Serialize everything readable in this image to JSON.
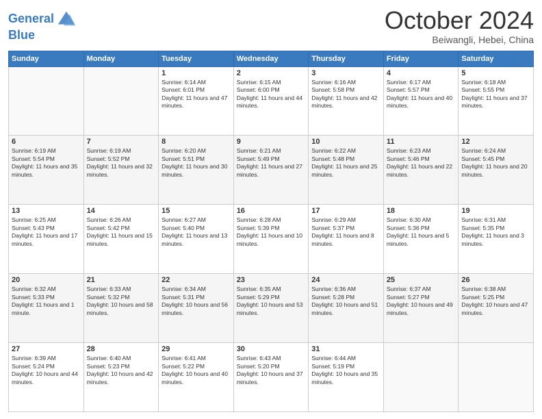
{
  "header": {
    "logo_line1": "General",
    "logo_line2": "Blue",
    "month": "October 2024",
    "location": "Beiwangli, Hebei, China"
  },
  "weekdays": [
    "Sunday",
    "Monday",
    "Tuesday",
    "Wednesday",
    "Thursday",
    "Friday",
    "Saturday"
  ],
  "weeks": [
    [
      {
        "day": "",
        "info": ""
      },
      {
        "day": "",
        "info": ""
      },
      {
        "day": "1",
        "info": "Sunrise: 6:14 AM\nSunset: 6:01 PM\nDaylight: 11 hours and 47 minutes."
      },
      {
        "day": "2",
        "info": "Sunrise: 6:15 AM\nSunset: 6:00 PM\nDaylight: 11 hours and 44 minutes."
      },
      {
        "day": "3",
        "info": "Sunrise: 6:16 AM\nSunset: 5:58 PM\nDaylight: 11 hours and 42 minutes."
      },
      {
        "day": "4",
        "info": "Sunrise: 6:17 AM\nSunset: 5:57 PM\nDaylight: 11 hours and 40 minutes."
      },
      {
        "day": "5",
        "info": "Sunrise: 6:18 AM\nSunset: 5:55 PM\nDaylight: 11 hours and 37 minutes."
      }
    ],
    [
      {
        "day": "6",
        "info": "Sunrise: 6:19 AM\nSunset: 5:54 PM\nDaylight: 11 hours and 35 minutes."
      },
      {
        "day": "7",
        "info": "Sunrise: 6:19 AM\nSunset: 5:52 PM\nDaylight: 11 hours and 32 minutes."
      },
      {
        "day": "8",
        "info": "Sunrise: 6:20 AM\nSunset: 5:51 PM\nDaylight: 11 hours and 30 minutes."
      },
      {
        "day": "9",
        "info": "Sunrise: 6:21 AM\nSunset: 5:49 PM\nDaylight: 11 hours and 27 minutes."
      },
      {
        "day": "10",
        "info": "Sunrise: 6:22 AM\nSunset: 5:48 PM\nDaylight: 11 hours and 25 minutes."
      },
      {
        "day": "11",
        "info": "Sunrise: 6:23 AM\nSunset: 5:46 PM\nDaylight: 11 hours and 22 minutes."
      },
      {
        "day": "12",
        "info": "Sunrise: 6:24 AM\nSunset: 5:45 PM\nDaylight: 11 hours and 20 minutes."
      }
    ],
    [
      {
        "day": "13",
        "info": "Sunrise: 6:25 AM\nSunset: 5:43 PM\nDaylight: 11 hours and 17 minutes."
      },
      {
        "day": "14",
        "info": "Sunrise: 6:26 AM\nSunset: 5:42 PM\nDaylight: 11 hours and 15 minutes."
      },
      {
        "day": "15",
        "info": "Sunrise: 6:27 AM\nSunset: 5:40 PM\nDaylight: 11 hours and 13 minutes."
      },
      {
        "day": "16",
        "info": "Sunrise: 6:28 AM\nSunset: 5:39 PM\nDaylight: 11 hours and 10 minutes."
      },
      {
        "day": "17",
        "info": "Sunrise: 6:29 AM\nSunset: 5:37 PM\nDaylight: 11 hours and 8 minutes."
      },
      {
        "day": "18",
        "info": "Sunrise: 6:30 AM\nSunset: 5:36 PM\nDaylight: 11 hours and 5 minutes."
      },
      {
        "day": "19",
        "info": "Sunrise: 6:31 AM\nSunset: 5:35 PM\nDaylight: 11 hours and 3 minutes."
      }
    ],
    [
      {
        "day": "20",
        "info": "Sunrise: 6:32 AM\nSunset: 5:33 PM\nDaylight: 11 hours and 1 minute."
      },
      {
        "day": "21",
        "info": "Sunrise: 6:33 AM\nSunset: 5:32 PM\nDaylight: 10 hours and 58 minutes."
      },
      {
        "day": "22",
        "info": "Sunrise: 6:34 AM\nSunset: 5:31 PM\nDaylight: 10 hours and 56 minutes."
      },
      {
        "day": "23",
        "info": "Sunrise: 6:35 AM\nSunset: 5:29 PM\nDaylight: 10 hours and 53 minutes."
      },
      {
        "day": "24",
        "info": "Sunrise: 6:36 AM\nSunset: 5:28 PM\nDaylight: 10 hours and 51 minutes."
      },
      {
        "day": "25",
        "info": "Sunrise: 6:37 AM\nSunset: 5:27 PM\nDaylight: 10 hours and 49 minutes."
      },
      {
        "day": "26",
        "info": "Sunrise: 6:38 AM\nSunset: 5:25 PM\nDaylight: 10 hours and 47 minutes."
      }
    ],
    [
      {
        "day": "27",
        "info": "Sunrise: 6:39 AM\nSunset: 5:24 PM\nDaylight: 10 hours and 44 minutes."
      },
      {
        "day": "28",
        "info": "Sunrise: 6:40 AM\nSunset: 5:23 PM\nDaylight: 10 hours and 42 minutes."
      },
      {
        "day": "29",
        "info": "Sunrise: 6:41 AM\nSunset: 5:22 PM\nDaylight: 10 hours and 40 minutes."
      },
      {
        "day": "30",
        "info": "Sunrise: 6:43 AM\nSunset: 5:20 PM\nDaylight: 10 hours and 37 minutes."
      },
      {
        "day": "31",
        "info": "Sunrise: 6:44 AM\nSunset: 5:19 PM\nDaylight: 10 hours and 35 minutes."
      },
      {
        "day": "",
        "info": ""
      },
      {
        "day": "",
        "info": ""
      }
    ]
  ]
}
